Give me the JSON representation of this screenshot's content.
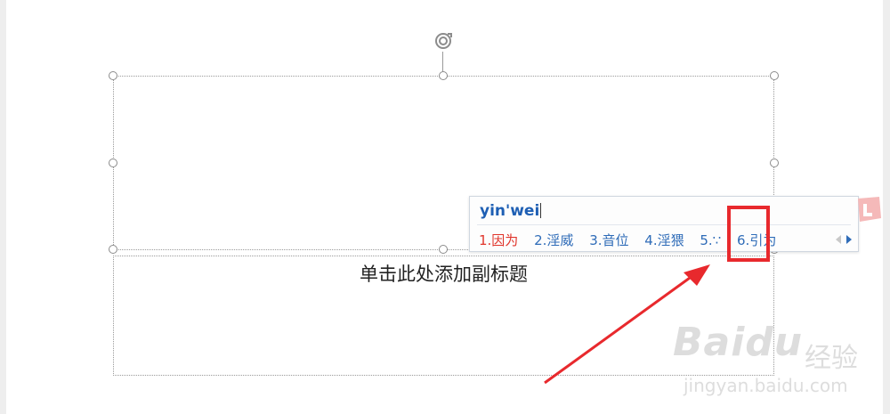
{
  "slide": {
    "subtitle_placeholder": "单击此处添加副标题"
  },
  "ime": {
    "pinyin": "yin'wei",
    "candidates": [
      {
        "label": "1.因为",
        "selected": true
      },
      {
        "label": "2.淫威",
        "selected": false
      },
      {
        "label": "3.音位",
        "selected": false
      },
      {
        "label": "4.淫猥",
        "selected": false
      },
      {
        "label": "5.∵",
        "selected": false
      },
      {
        "label": "6.引为",
        "selected": false
      }
    ],
    "logo_icon": "sogou-l-logo-icon",
    "selected_color": "#e0352b",
    "candidate_color": "#2f6cb8",
    "pinyin_color": "#1e5fb4"
  },
  "annotation": {
    "highlight_color": "#e8292d"
  },
  "watermark": {
    "brand": "Baidu",
    "cn": "经验",
    "url": "jingyan.baidu.com"
  }
}
